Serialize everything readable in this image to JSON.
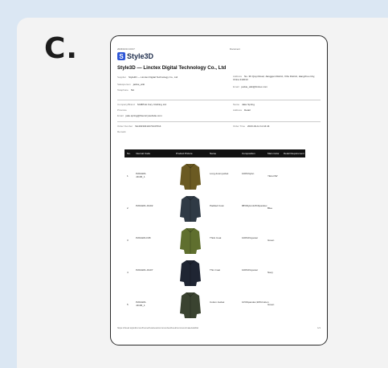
{
  "section_letter": "C.",
  "document": {
    "header_left": "2023/10/13 16:07",
    "header_center": "Document",
    "logo_text": "Style3D",
    "title": "Style3D — Linctex Digital Technology Co., Ltd",
    "supplier": {
      "label": "Supplier",
      "value": "Style3D — Linctex Digital Technology Co., Ltd"
    },
    "address": {
      "label": "Address",
      "value": "No. 36 Qiuyi Road, Jianggan District, Xihu District, Hangzhou City, China 310013"
    },
    "salesperson": {
      "label": "Salesperson",
      "value": "jackie_wiki"
    },
    "email1": {
      "label": "Email",
      "value": "jackie_wiki@linctex.com"
    },
    "telephone": {
      "label": "Telephone",
      "value": "NA"
    },
    "company_brand": {
      "label": "Company/Brand",
      "value": "SAMPLE Cory Clothing Ltd"
    },
    "name": {
      "label": "Name",
      "value": "Jake Spring"
    },
    "province": {
      "label": "Province",
      "value": ""
    },
    "address2": {
      "label": "Address",
      "value": "Detail"
    },
    "email2": {
      "label": "Email",
      "value": "jake.spring@thecorrywebsite.com"
    },
    "order_number": {
      "label": "Order Number",
      "value": "SH40230411074447614"
    },
    "order_time": {
      "label": "Order Time",
      "value": "2023-04-11 11:44:44"
    },
    "remark": {
      "label": "Remark",
      "value": ""
    },
    "table_headers": [
      "No.",
      "Internal Code",
      "Product Picture",
      "Name",
      "Composition",
      "Main Color",
      "Detail Requirement"
    ],
    "rows": [
      {
        "no": "1",
        "code": "P2DAW4-J4106_1",
        "name": "Long down jacket",
        "composition": "100%Nylon",
        "color": "YELLOW",
        "swatch": "#6b5a22"
      },
      {
        "no": "2",
        "code": "P2DAW4-J4102",
        "name": "Padded Coat",
        "composition": "88%Nylon12%Spandex",
        "color": "Blue",
        "swatch": "#2f3a45"
      },
      {
        "no": "3",
        "code": "P2DAW4-F08",
        "name": "Thick Coat",
        "composition": "100%Polyester",
        "color": "Green",
        "swatch": "#5f6f2e"
      },
      {
        "no": "4",
        "code": "P2DAW4-J4107",
        "name": "Thin Coat",
        "composition": "100%Polyester",
        "color": "Navy",
        "swatch": "#1f2533"
      },
      {
        "no": "5",
        "code": "P2DAW4-J4106_1",
        "name": "Cotton Jacket",
        "composition": "10%Spandex,90%Cotton",
        "color": "Green",
        "swatch": "#3a4330"
      }
    ],
    "footer_url": "https://cloud.style3d.com/home/business/common/textbook/common/materials/list",
    "footer_page": "1/1"
  }
}
